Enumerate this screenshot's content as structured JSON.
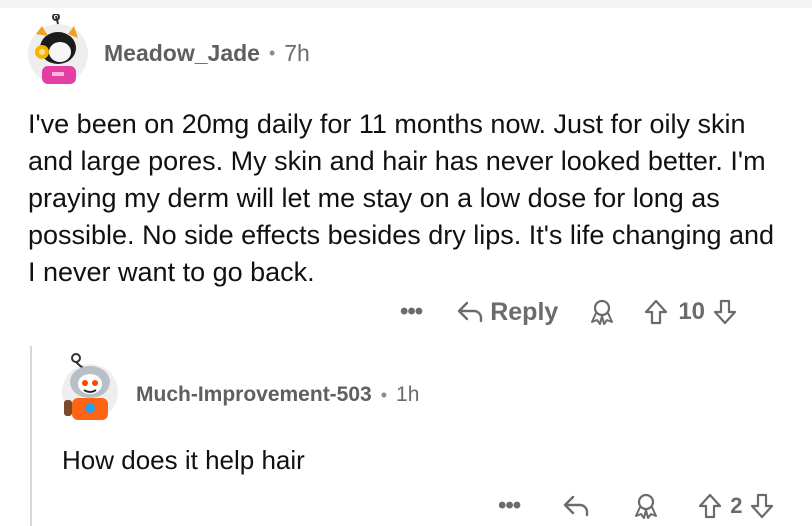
{
  "comments": [
    {
      "username": "Meadow_Jade",
      "separator": "•",
      "time": "7h",
      "body": "I've been on 20mg daily for 11 months now. Just for oily skin and large pores. My skin and hair has never looked better. I'm praying my derm will let me stay on a low dose for long as possible. No side effects besides dry lips. It's life changing and I never want to go back.",
      "actions": {
        "more": "•••",
        "reply_label": "Reply",
        "vote_count": "10"
      },
      "icons": [
        "avatar-icon",
        "more-icon",
        "reply-icon",
        "award-icon",
        "upvote-icon",
        "downvote-icon"
      ]
    },
    {
      "username": "Much-Improvement-503",
      "separator": "•",
      "time": "1h",
      "body": "How does it help hair",
      "actions": {
        "more": "•••",
        "vote_count": "2"
      },
      "icons": [
        "avatar-icon",
        "more-icon",
        "reply-icon",
        "award-icon",
        "upvote-icon",
        "downvote-icon"
      ]
    }
  ],
  "colors": {
    "meta": "#6b6b6b",
    "text": "#111111",
    "thread_line": "#d8d8d8"
  }
}
